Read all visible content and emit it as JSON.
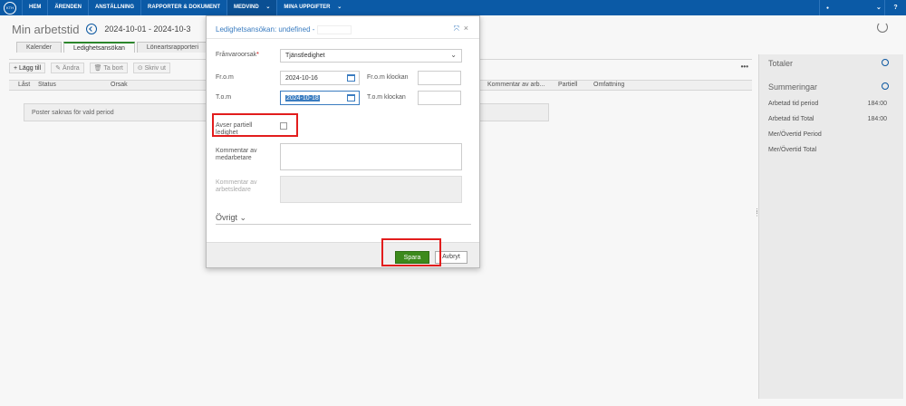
{
  "nav": {
    "logo": "KTH",
    "items": [
      "HEM",
      "ÄRENDEN",
      "ANSTÄLLNING",
      "RAPPORTER & DOKUMENT",
      "MEDVIND",
      "MINA UPPGIFTER"
    ],
    "medvind_chevron": "⌄",
    "uppgifter_chevron": "⌄",
    "user_icon": "●",
    "user_chevron": "⌄",
    "help_icon": "?"
  },
  "page": {
    "title": "Min arbetstid",
    "date_range": "2024-10-01 - 2024-10-3"
  },
  "tabs": [
    "Kalender",
    "Ledighetsansökan",
    "Löneartsrapporteri"
  ],
  "toolbar": {
    "add": "+ Lägg till",
    "edit": "✎ Ändra",
    "delete": "🗑 Ta bort",
    "sign": "⊙ Skriv ut",
    "more": "•••"
  },
  "grid": {
    "columns": [
      "Låst",
      "Status",
      "Orsak",
      "Kommentar av arb...",
      "Partiell",
      "Omfattning"
    ],
    "empty": "Poster saknas för vald period"
  },
  "right_panel": {
    "totals_title": "Totaler",
    "summary_title": "Summeringar",
    "rows": [
      {
        "label": "Arbetad tid period",
        "value": "184:00"
      },
      {
        "label": "Arbetad tid Total",
        "value": "184:00"
      },
      {
        "label": "Mer/Övertid Period",
        "value": ""
      },
      {
        "label": "Mer/Övertid Total",
        "value": ""
      }
    ]
  },
  "modal": {
    "title": "Ledighetsansökan: undefined - ",
    "expand": "⤧",
    "close": "×",
    "cause_label": "Frånvaroorsak",
    "required_mark": "*",
    "cause_value": "Tjänstledighet",
    "from_label": "Fr.o.m",
    "from_value": "2024-10-16",
    "from_time_label": "Fr.o.m klockan",
    "to_label": "T.o.m",
    "to_value": "2024-10-18",
    "to_time_label": "T.o.m klockan",
    "partial_label": "Avser partiell ledighet",
    "employee_comment_label": "Kommentar av medarbetare",
    "manager_comment_label": "Kommentar av arbetsledare",
    "other_label": "Övrigt ⌄",
    "save": "Spara",
    "cancel": "Avbryt"
  },
  "colors": {
    "nav_bg": "#0b5aa6",
    "save_bg": "#3c8a1c",
    "highlight": "#e21d1d",
    "link": "#3a7cc0"
  }
}
